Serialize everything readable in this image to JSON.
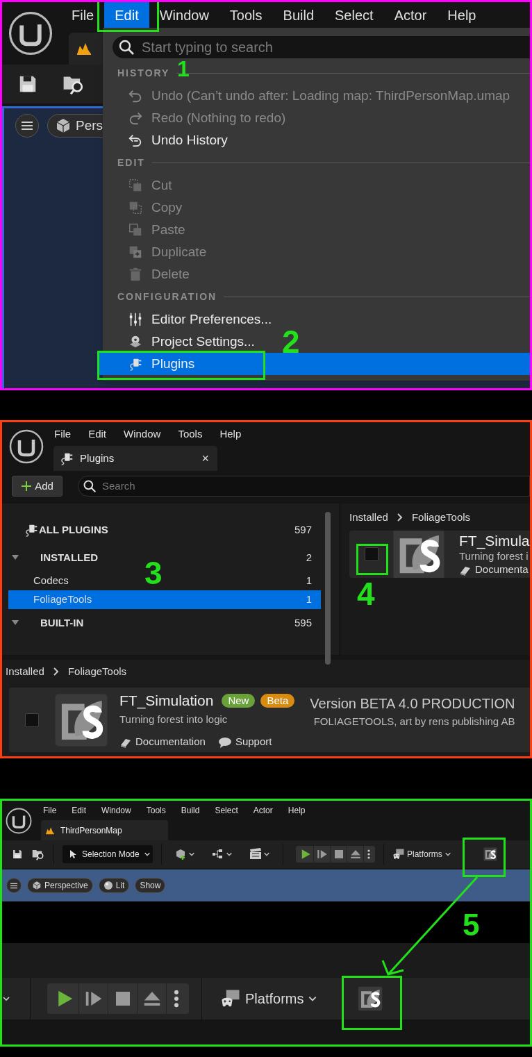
{
  "edit_menu_screen": {
    "menu_bar": [
      {
        "label": "File",
        "selected": false
      },
      {
        "label": "Edit",
        "selected": true
      },
      {
        "label": "Window",
        "selected": false
      },
      {
        "label": "Tools",
        "selected": false
      },
      {
        "label": "Build",
        "selected": false
      },
      {
        "label": "Select",
        "selected": false
      },
      {
        "label": "Actor",
        "selected": false
      },
      {
        "label": "Help",
        "selected": false
      }
    ],
    "viewport_chip": "Pers",
    "dropdown": {
      "search_placeholder": "Start typing to search",
      "sections": [
        {
          "heading": "HISTORY",
          "items": [
            {
              "label": "Undo (Can’t undo after: Loading map: ThirdPersonMap.umap",
              "disabled": true,
              "selected": false
            },
            {
              "label": "Redo (Nothing to redo)",
              "disabled": true,
              "selected": false
            },
            {
              "label": "Undo History",
              "disabled": false,
              "selected": false
            }
          ]
        },
        {
          "heading": "EDIT",
          "items": [
            {
              "label": "Cut",
              "disabled": true,
              "selected": false
            },
            {
              "label": "Copy",
              "disabled": true,
              "selected": false
            },
            {
              "label": "Paste",
              "disabled": true,
              "selected": false
            },
            {
              "label": "Duplicate",
              "disabled": true,
              "selected": false
            },
            {
              "label": "Delete",
              "disabled": true,
              "selected": false
            }
          ]
        },
        {
          "heading": "CONFIGURATION",
          "items": [
            {
              "label": "Editor Preferences...",
              "disabled": false,
              "selected": false
            },
            {
              "label": "Project Settings...",
              "disabled": false,
              "selected": false
            },
            {
              "label": "Plugins",
              "disabled": false,
              "selected": true
            }
          ]
        }
      ]
    },
    "annotations": [
      "1",
      "2"
    ]
  },
  "plugins_screen": {
    "menu_bar": [
      "File",
      "Edit",
      "Window",
      "Tools",
      "Help"
    ],
    "tab": {
      "label": "Plugins",
      "close": "×"
    },
    "add_button": "Add",
    "search_placeholder": "Search",
    "sidebar": [
      {
        "kind": "root",
        "label": "ALL PLUGINS",
        "count": "597",
        "selected": false
      },
      {
        "kind": "category",
        "label": "INSTALLED",
        "count": "2",
        "expanded": true,
        "selected": false,
        "children": [
          {
            "label": "Codecs",
            "count": "1",
            "selected": false
          },
          {
            "label": "FoliageTools",
            "count": "1",
            "selected": true
          }
        ]
      },
      {
        "kind": "category",
        "label": "BUILT-IN",
        "count": "595",
        "expanded": true,
        "selected": false
      }
    ],
    "breadcrumb": [
      "Installed",
      "FoliageTools"
    ],
    "card": {
      "checked": false,
      "title": "FT_Simula",
      "description": "Turning forest i",
      "link": "Documenta"
    },
    "detail_breadcrumb": [
      "Installed",
      "FoliageTools"
    ],
    "detail_card": {
      "checked": false,
      "title": "FT_Simulation",
      "badges": [
        {
          "label": "New",
          "color": "#6aa23a"
        },
        {
          "label": "Beta",
          "color": "#d98b10"
        }
      ],
      "description": "Turning forest into logic",
      "version": "Version BETA 4.0 PRODUCTION",
      "author": "FOLIAGETOOLS, art by rens publishing AB",
      "links": [
        "Documentation",
        "Support"
      ]
    },
    "annotations": [
      "3",
      "4"
    ]
  },
  "toolbar_screen": {
    "menu_bar": [
      "File",
      "Edit",
      "Window",
      "Tools",
      "Build",
      "Select",
      "Actor",
      "Help"
    ],
    "tab": "ThirdPersonMap",
    "mode_dropdown": "Selection Mode",
    "platforms": "Platforms",
    "viewport_buttons": [
      "Perspective",
      "Lit",
      "Show"
    ],
    "zoomed_platforms": "Platforms",
    "annotations": [
      "5"
    ]
  }
}
